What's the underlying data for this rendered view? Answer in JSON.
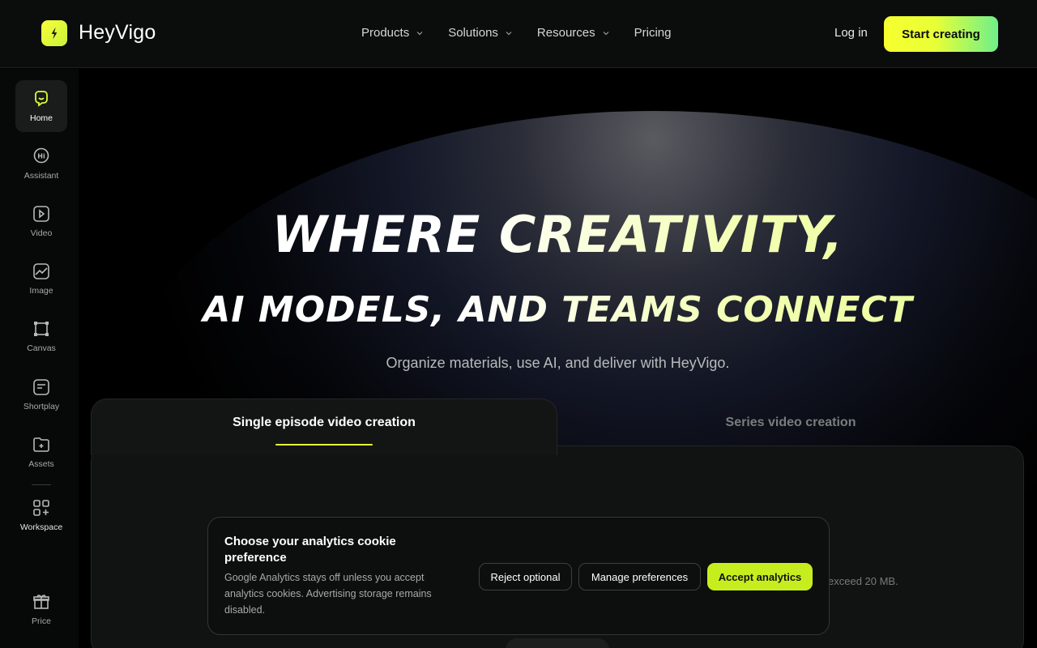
{
  "brand": {
    "name": "HeyVigo"
  },
  "nav": {
    "items": [
      {
        "label": "Products",
        "has_dropdown": true
      },
      {
        "label": "Solutions",
        "has_dropdown": true
      },
      {
        "label": "Resources",
        "has_dropdown": true
      },
      {
        "label": "Pricing",
        "has_dropdown": false
      }
    ],
    "login_label": "Log in",
    "cta_label": "Start creating"
  },
  "sidebar": {
    "items": [
      {
        "label": "Home",
        "icon": "home-icon",
        "active": true
      },
      {
        "label": "Assistant",
        "icon": "assistant-icon",
        "active": false
      },
      {
        "label": "Video",
        "icon": "video-icon",
        "active": false
      },
      {
        "label": "Image",
        "icon": "image-icon",
        "active": false
      },
      {
        "label": "Canvas",
        "icon": "canvas-icon",
        "active": false
      },
      {
        "label": "Shortplay",
        "icon": "shortplay-icon",
        "active": false
      },
      {
        "label": "Assets",
        "icon": "assets-icon",
        "active": false
      },
      {
        "label": "Workspace",
        "icon": "workspace-icon",
        "active": false
      },
      {
        "label": "Price",
        "icon": "gift-icon",
        "active": false
      }
    ]
  },
  "hero": {
    "headline_line1": "Where Creativity,",
    "headline_line2": "AI Models, and Teams Connect",
    "subtitle": "Organize materials, use AI, and deliver with HeyVigo."
  },
  "tabs": [
    {
      "label": "Single episode video creation",
      "active": true
    },
    {
      "label": "Series video creation",
      "active": false
    }
  ],
  "panel": {
    "hint_fragment": "exceed 20 MB."
  },
  "cookie": {
    "title": "Choose your analytics cookie preference",
    "body": "Google Analytics stays off unless you accept analytics cookies. Advertising storage remains disabled.",
    "reject_label": "Reject optional",
    "manage_label": "Manage preferences",
    "accept_label": "Accept analytics"
  },
  "colors": {
    "accent": "#c6ee1e",
    "cta_gradient_start": "#f7ff2e",
    "cta_gradient_end": "#6fef8a",
    "background": "#000000"
  }
}
